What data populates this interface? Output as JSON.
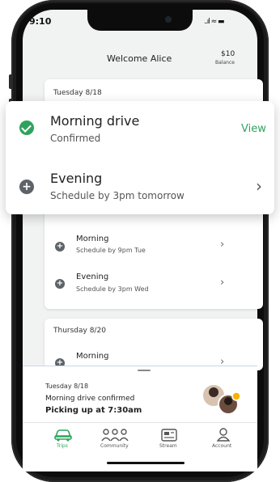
{
  "status": {
    "time": "9:10",
    "indicators": "..ıl ≈ ▬"
  },
  "header": {
    "title": "Welcome Alice",
    "balance_amount": "$10",
    "balance_label": "Balance"
  },
  "overlay": {
    "row1": {
      "title": "Morning drive",
      "subtitle": "Confirmed",
      "action": "View"
    },
    "row2": {
      "title": "Evening",
      "subtitle": "Schedule by 3pm tomorrow"
    }
  },
  "days": [
    {
      "label": "Tuesday 8/18"
    },
    {
      "label": "Thursday 8/20",
      "rows": [
        {
          "title": "Morning"
        }
      ]
    }
  ],
  "wednesday": {
    "rows": [
      {
        "title": "Morning",
        "subtitle": "Schedule by 9pm Tue"
      },
      {
        "title": "Evening",
        "subtitle": "Schedule by 3pm Wed"
      }
    ]
  },
  "sheet": {
    "date": "Tuesday 8/18",
    "status": "Morning drive confirmed",
    "pickup": "Picking up at 7:30am"
  },
  "tabs": [
    {
      "label": "Trips",
      "icon": "car-icon"
    },
    {
      "label": "Community",
      "icon": "community-icon"
    },
    {
      "label": "Stream",
      "icon": "stream-icon"
    },
    {
      "label": "Account",
      "icon": "account-icon"
    }
  ],
  "colors": {
    "accent": "#2fa35d",
    "icon_gray": "#5d6368",
    "screen_bg": "#f1f2f2"
  }
}
